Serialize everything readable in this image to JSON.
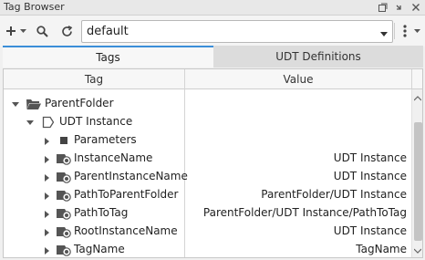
{
  "window": {
    "title": "Tag Browser",
    "icons": [
      "undock-icon",
      "minimize-icon",
      "close-icon"
    ]
  },
  "toolbar": {
    "provider_value": "default",
    "icons": [
      "add-tag-icon",
      "dropdown-caret-icon",
      "search-icon",
      "refresh-icon",
      "kebab-menu-icon"
    ]
  },
  "tabs": [
    {
      "label": "Tags",
      "active": true
    },
    {
      "label": "UDT Definitions",
      "active": false
    }
  ],
  "columns": {
    "tag": "Tag",
    "value": "Value"
  },
  "rows": [
    {
      "name": "ParentFolder",
      "value": "",
      "icon": "folder-icon"
    },
    {
      "name": "UDT Instance",
      "value": "",
      "icon": "udt-instance-icon"
    },
    {
      "name": "Parameters",
      "value": "",
      "icon": "parameters-icon"
    },
    {
      "name": "InstanceName",
      "value": "UDT Instance",
      "icon": "tag-icon"
    },
    {
      "name": "ParentInstanceName",
      "value": "UDT Instance",
      "icon": "tag-icon"
    },
    {
      "name": "PathToParentFolder",
      "value": "ParentFolder/UDT Instance",
      "icon": "tag-icon"
    },
    {
      "name": "PathToTag",
      "value": "ParentFolder/UDT Instance/PathToTag",
      "icon": "tag-icon"
    },
    {
      "name": "RootInstanceName",
      "value": "UDT Instance",
      "icon": "tag-icon"
    },
    {
      "name": "TagName",
      "value": "TagName",
      "icon": "tag-icon"
    }
  ],
  "colors": {
    "accent": "#3b8ed8",
    "icon_dark": "#555555"
  }
}
